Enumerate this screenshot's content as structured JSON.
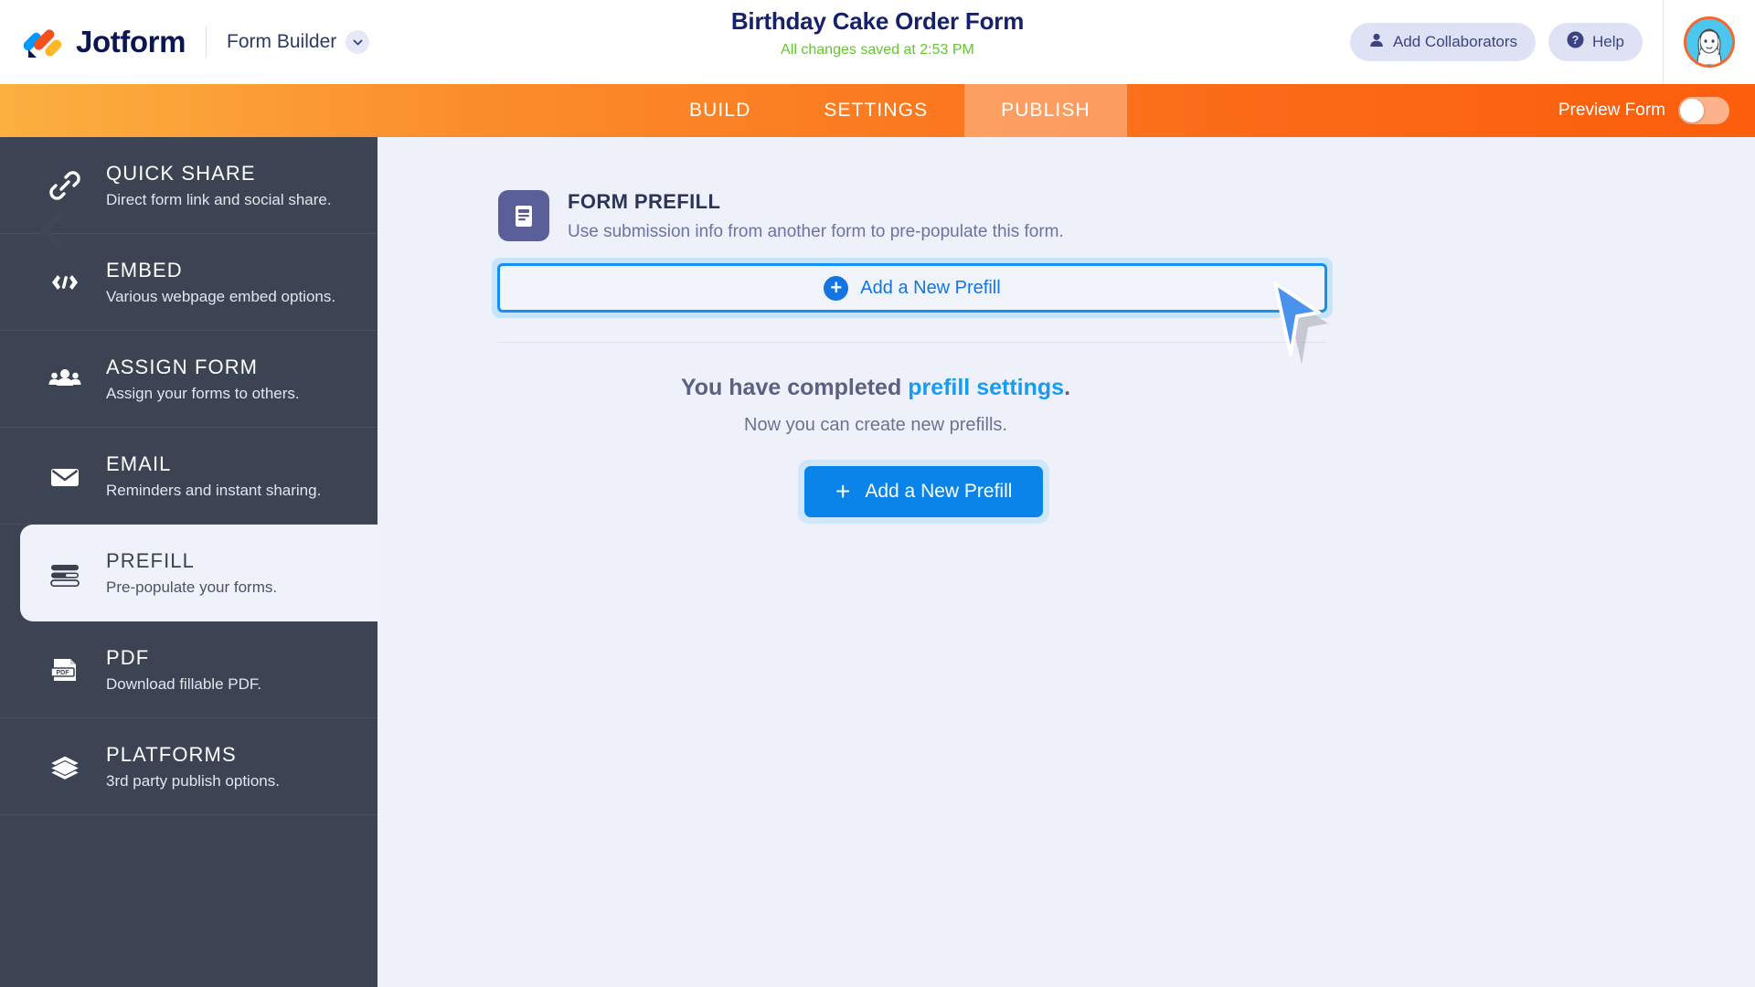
{
  "header": {
    "brand": "Jotform",
    "logo_icon": "jotform-logo-icon",
    "form_builder_label": "Form Builder",
    "chevron_icon": "chevron-down-icon",
    "form_title": "Birthday Cake Order Form",
    "save_status": "All changes saved at 2:53 PM",
    "add_collaborators_label": "Add Collaborators",
    "collaborators_icon": "person-icon",
    "help_label": "Help",
    "help_icon": "question-mark-icon",
    "avatar_icon": "user-avatar",
    "colors": {
      "brand_navy": "#0a1551",
      "save_green": "#63c62f",
      "pill_bg": "#dfe2f5",
      "avatar_ring": "#f4682a",
      "avatar_bg": "#4cc6ef"
    }
  },
  "navbar": {
    "tabs": [
      {
        "label": "BUILD",
        "active": false
      },
      {
        "label": "SETTINGS",
        "active": false
      },
      {
        "label": "PUBLISH",
        "active": true
      }
    ],
    "preview_label": "Preview Form",
    "preview_toggle_state": "off",
    "accent": "#fb6a18"
  },
  "sidebar": {
    "items": [
      {
        "title": "QUICK SHARE",
        "desc": "Direct form link and social share.",
        "icon": "link-icon",
        "active": false
      },
      {
        "title": "EMBED",
        "desc": "Various webpage embed options.",
        "icon": "code-brackets-icon",
        "active": false
      },
      {
        "title": "ASSIGN FORM",
        "desc": "Assign your forms to others.",
        "icon": "people-group-icon",
        "active": false
      },
      {
        "title": "EMAIL",
        "desc": "Reminders and instant sharing.",
        "icon": "envelope-icon",
        "active": false
      },
      {
        "title": "PREFILL",
        "desc": "Pre-populate your forms.",
        "icon": "prefill-bars-icon",
        "active": true
      },
      {
        "title": "PDF",
        "desc": "Download fillable PDF.",
        "icon": "pdf-file-icon",
        "active": false
      },
      {
        "title": "PLATFORMS",
        "desc": "3rd party publish options.",
        "icon": "layers-icon",
        "active": false
      }
    ],
    "bg": "#3c4454",
    "active_bg": "#f0f2fb"
  },
  "main": {
    "collapse_icon": "chevron-left-icon",
    "panel_icon": "document-prefill-icon",
    "panel_title": "FORM PREFILL",
    "panel_subtitle": "Use submission info from another form to pre-populate this form.",
    "add_prefill_bar_label": "Add a New Prefill",
    "add_prefill_bar_icon": "plus-circle-icon",
    "empty_state": {
      "line1_prefix": "You have completed ",
      "line1_link": "prefill settings",
      "line1_suffix": ".",
      "line2": "Now you can create new prefills."
    },
    "primary_button_label": "Add a New Prefill",
    "primary_button_icon": "plus-icon",
    "cursor_icon": "mouse-cursor-arrow",
    "colors": {
      "content_bg": "#eef0fa",
      "highlight_border": "#1690f0",
      "highlight_glow": "#c6e4fc",
      "link_blue": "#199bf0",
      "primary_blue": "#0a84e8",
      "panel_icon_bg": "#5a5f99"
    }
  }
}
